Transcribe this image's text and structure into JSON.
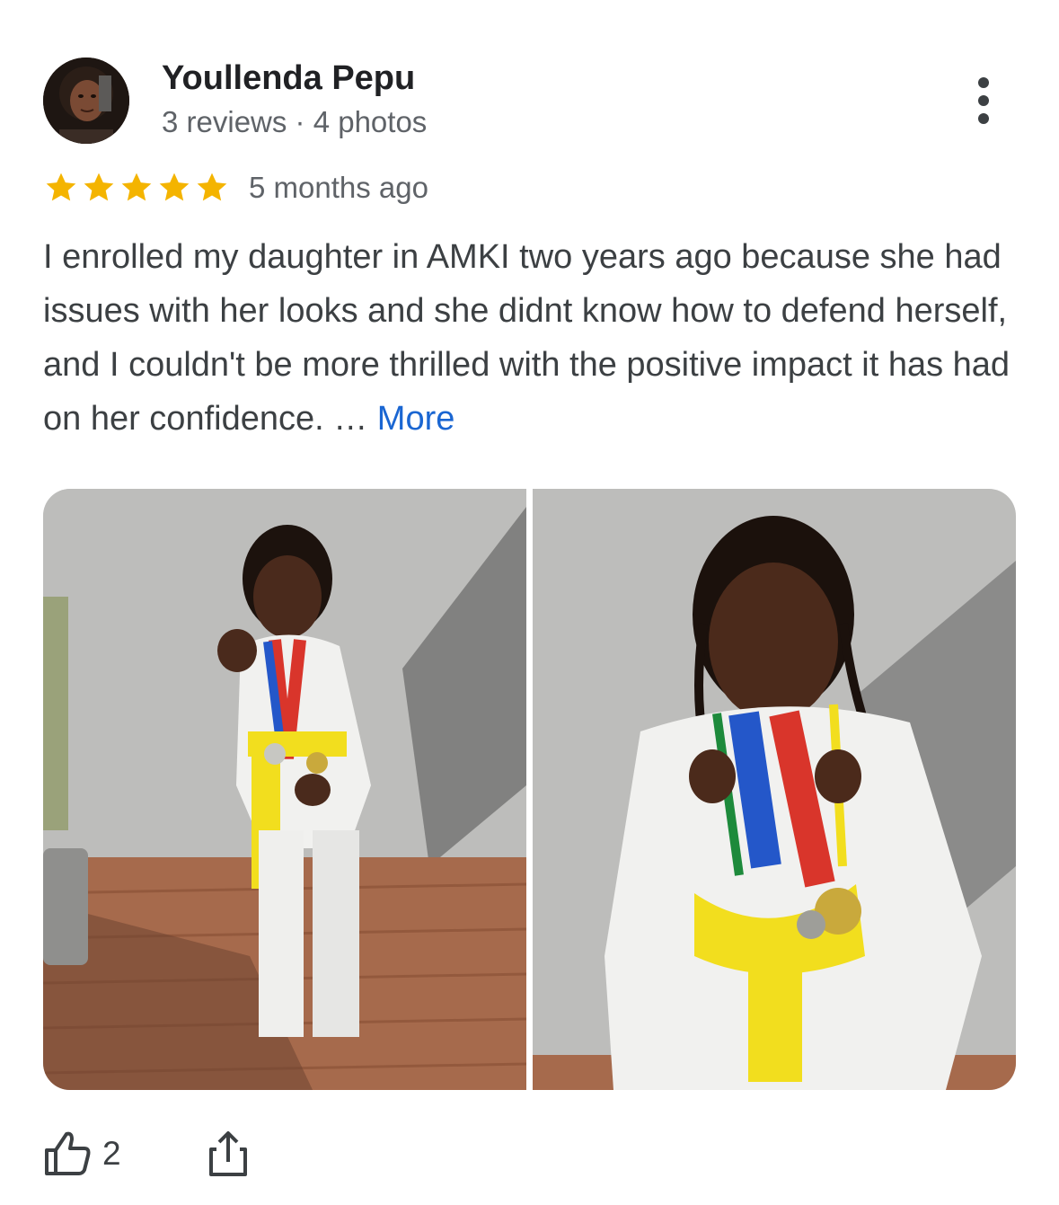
{
  "author": {
    "name": "Youllenda Pepu",
    "meta": "3 reviews · 4 photos"
  },
  "rating": {
    "stars": 5,
    "max": 5,
    "color": "#f4b400"
  },
  "date": "5 months ago",
  "review": {
    "text": "I enrolled my daughter in AMKI two years ago because she had issues with her looks and she didnt know how to defend herself, and I couldn't be more thrilled with the positive impact it has had on her confidence. …",
    "more_label": "More",
    "link_color": "#1a66d2"
  },
  "photos": [
    {
      "icon": "photo-girl-karate-stance"
    },
    {
      "icon": "photo-girl-with-medals-closeup"
    }
  ],
  "actions": {
    "like_count": "2",
    "like_icon": "thumb-up-icon",
    "share_icon": "share-icon"
  }
}
